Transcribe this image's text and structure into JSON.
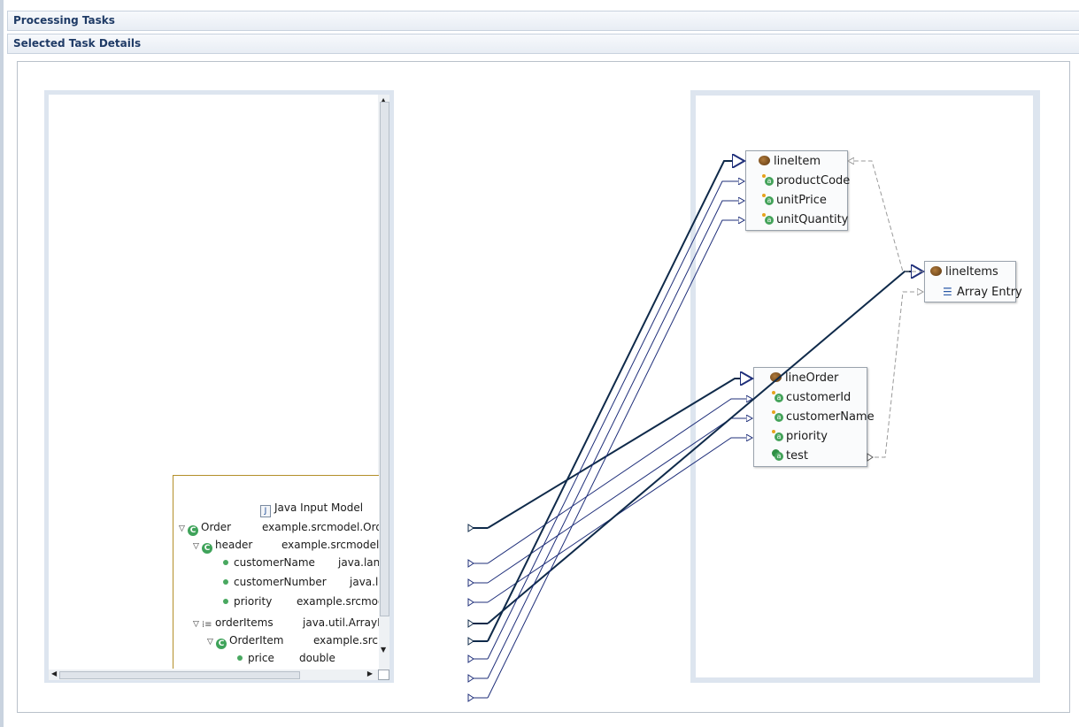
{
  "sections": {
    "processing_tasks": "Processing Tasks",
    "selected_task_details": "Selected Task Details"
  },
  "source_model": {
    "title": "Java Input Model",
    "rows": [
      {
        "name": "Order",
        "type": "example.srcmodel.Ord"
      },
      {
        "name": "header",
        "type": "example.srcmodel."
      },
      {
        "name": "customerName",
        "type": "java.lang"
      },
      {
        "name": "customerNumber",
        "type": "java.la"
      },
      {
        "name": "priority",
        "type": "example.srcmod"
      },
      {
        "name": "orderItems",
        "type": "java.util.ArrayLi"
      },
      {
        "name": "OrderItem",
        "type": "example.srcr"
      },
      {
        "name": "price",
        "type": "double"
      }
    ]
  },
  "target_nodes": {
    "line_item": {
      "title": "lineItem",
      "fields": [
        "productCode",
        "unitPrice",
        "unitQuantity"
      ]
    },
    "line_items": {
      "title": "lineItems",
      "fields": [
        "Array Entry"
      ]
    },
    "line_order": {
      "title": "lineOrder",
      "fields": [
        "customerId",
        "customerName",
        "priority",
        "test"
      ]
    }
  },
  "colors": {
    "section_title": "#1f3b66",
    "panel_border": "#dde5ef",
    "mapping_line": "#1f2f7a",
    "mapping_line_bold": "#0f2a4a",
    "dependency_line": "#9a9a9a"
  },
  "icons": {
    "class": "class-icon",
    "field": "field-icon",
    "bean": "bean-icon",
    "attribute": "attribute-icon",
    "list": "list-icon",
    "java_file": "java-file-icon"
  }
}
